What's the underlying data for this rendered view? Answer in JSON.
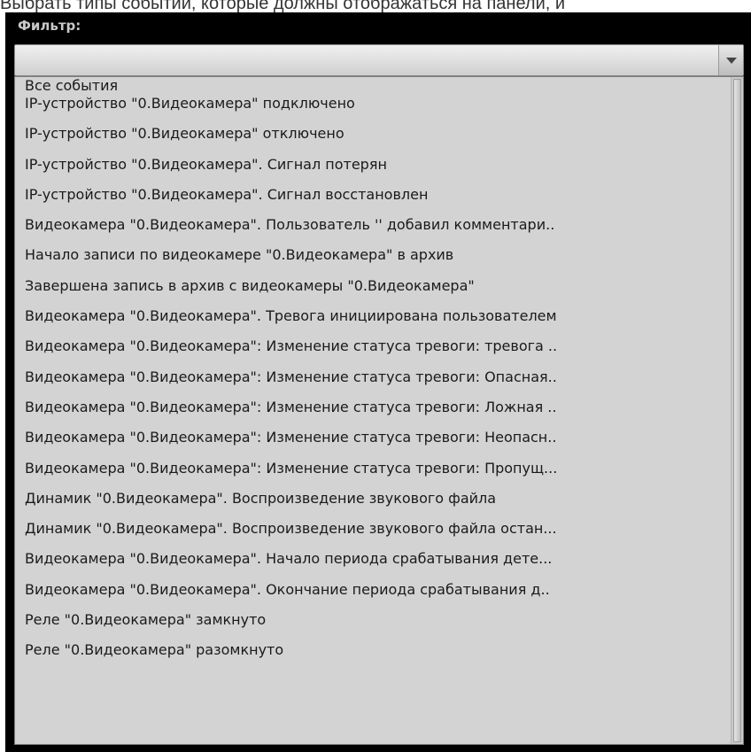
{
  "caption": "Выбрать типы событий, которые должны отображаться на панели, и",
  "filter": {
    "label": "Фильтр:",
    "value": "",
    "dropdown_icon": "chevron-down-icon"
  },
  "events": [
    "Все события",
    "IP-устройство \"0.Видеокамера\" подключено",
    "IP-устройство \"0.Видеокамера\" отключено",
    "IP-устройство \"0.Видеокамера\". Сигнал потерян",
    "IP-устройство \"0.Видеокамера\". Сигнал восстановлен",
    "Видеокамера \"0.Видеокамера\". Пользователь '' добавил комментари..",
    "Начало записи по видеокамере \"0.Видеокамера\" в архив",
    "Завершена запись в архив  с видеокамеры \"0.Видеокамера\"",
    "Видеокамера \"0.Видеокамера\". Тревога инициирована пользователем",
    "Видеокамера \"0.Видеокамера\": Изменение статуса тревоги: тревога ..",
    "Видеокамера \"0.Видеокамера\": Изменение статуса тревоги: Опасная..",
    "Видеокамера \"0.Видеокамера\": Изменение статуса тревоги: Ложная ..",
    "Видеокамера \"0.Видеокамера\": Изменение статуса тревоги: Неопасн..",
    "Видеокамера \"0.Видеокамера\": Изменение статуса тревоги: Пропущ...",
    "Динамик \"0.Видеокамера\". Воспроизведение звукового файла",
    "Динамик \"0.Видеокамера\". Воспроизведение звукового файла остан...",
    "Видеокамера \"0.Видеокамера\". Начало периода срабатывания дете...",
    "Видеокамера \"0.Видеокамера\". Окончание периода срабатывания д..",
    "Реле \"0.Видеокамера\" замкнуто",
    "Реле \"0.Видеокамера\" разомкнуто"
  ]
}
